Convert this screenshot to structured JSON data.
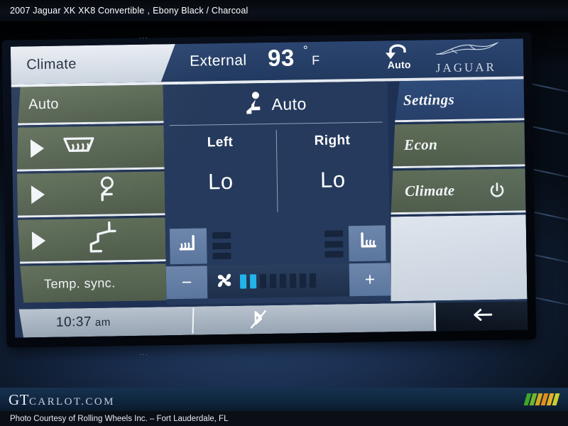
{
  "listing": {
    "title": "2007 Jaguar XK XK8 Convertible",
    "separator": ",",
    "colors": "Ebony Black / Charcoal"
  },
  "screen": {
    "header": {
      "menu_title": "Climate",
      "external_label": "External",
      "external_temp": "93",
      "degree_symbol": "°",
      "unit": "F",
      "recirculation_label": "Auto",
      "recirculation_icon": "recirculate-auto-icon",
      "brand_name": "JAGUAR",
      "brand_icon": "jaguar-leaper-icon"
    },
    "left_column": [
      {
        "label": "Auto",
        "icon": "",
        "arrow": false
      },
      {
        "label": "",
        "icon": "windshield-defrost-icon",
        "arrow": true
      },
      {
        "label": "",
        "icon": "face-vent-icon",
        "arrow": true
      },
      {
        "label": "",
        "icon": "feet-vent-icon",
        "arrow": true
      },
      {
        "label": "Temp. sync.",
        "icon": "",
        "arrow": false
      }
    ],
    "center": {
      "mode_label": "Auto",
      "mode_icon": "seated-person-icon",
      "zones": [
        {
          "name": "Left",
          "value": "Lo"
        },
        {
          "name": "Right",
          "value": "Lo"
        }
      ],
      "seat_heaters": {
        "left_icon": "seat-heater-left-icon",
        "right_icon": "seat-heater-right-icon",
        "levels": 3,
        "left_level": 0,
        "right_level": 0
      },
      "fan": {
        "icon": "fan-icon",
        "decrease_label": "−",
        "increase_label": "+",
        "bars_total": 8,
        "bars_active": 2,
        "active_color": "#22b4ea",
        "inactive_color": "#16243c"
      }
    },
    "right_column": [
      {
        "label": "Settings",
        "icon": "",
        "state": "selected"
      },
      {
        "label": "Econ",
        "icon": "",
        "state": "normal"
      },
      {
        "label": "Climate",
        "icon": "power-icon",
        "state": "normal"
      }
    ],
    "bottom_bar": {
      "clock_time": "10:37",
      "clock_ampm": "am",
      "bluetooth_icon": "bluetooth-muted-icon",
      "back_icon": "back-arrow-icon"
    }
  },
  "footer": {
    "logo_prefix": "GT",
    "logo_suffix": "CARLOT.COM",
    "stripe_colors": [
      "#3fa62a",
      "#6fb82b",
      "#d5a81e",
      "#e0901c",
      "#e2b022",
      "#c9d12a"
    ],
    "credit": "Photo Courtesy of Rolling Wheels Inc. – Fort Lauderdale, FL"
  },
  "theme": {
    "screen_blue": "#253a5c",
    "panel_green": "#566450",
    "selected_blue": "#2e4b79",
    "light_panel": "#dfe5ed"
  }
}
